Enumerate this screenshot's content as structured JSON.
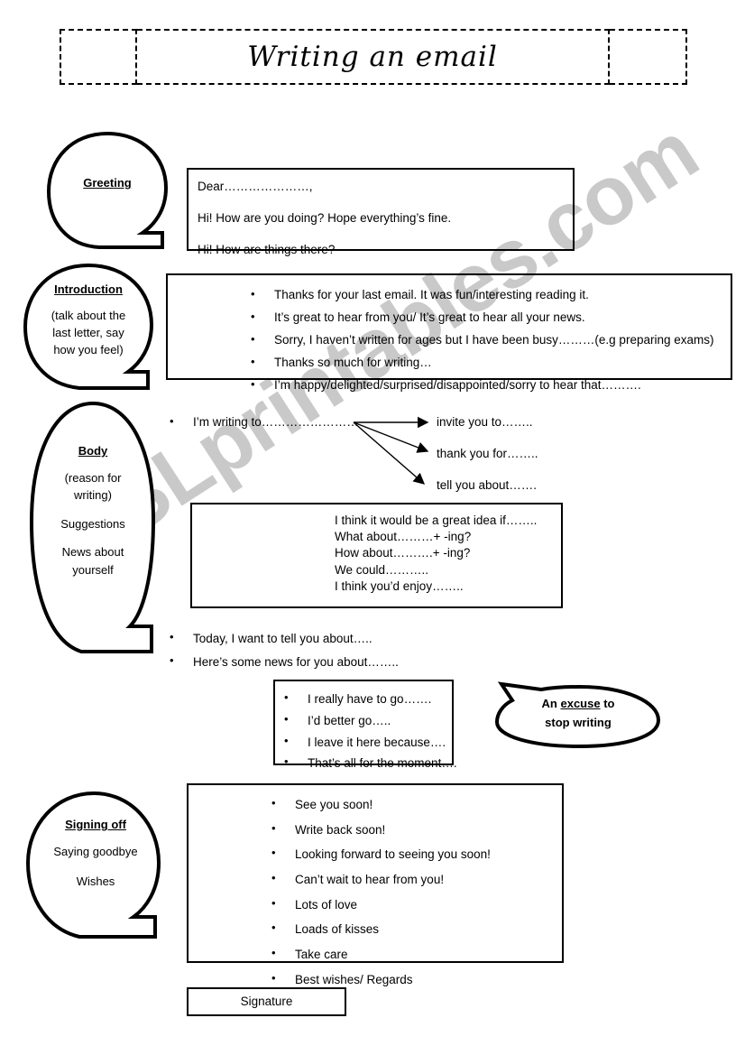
{
  "title": "Writing an email",
  "watermark": "ESLprintables.com",
  "sections": {
    "greeting": {
      "bubble": {
        "title": "Greeting",
        "lines": []
      },
      "lines": [
        "Dear…………………,",
        "Hi! How are you doing? Hope everything’s fine.",
        "Hi! How are things there?"
      ]
    },
    "introduction": {
      "bubble": {
        "title": "Introduction",
        "lines": [
          "(talk about the",
          "last letter, say",
          "how you feel)"
        ]
      },
      "bullets": [
        "Thanks for your last email. It was fun/interesting reading it.",
        "It’s great to hear from you/ It’s great to hear all your news.",
        "Sorry, I haven’t written for ages but I have been busy………(e.g preparing exams)",
        "Thanks so much for writing…",
        "I’m happy/delighted/surprised/disappointed/sorry to hear that………."
      ]
    },
    "body": {
      "bubble": {
        "title": "Body",
        "lines": [
          "(reason for",
          "writing)",
          "Suggestions",
          "News about",
          "yourself"
        ]
      },
      "writing_to_bullet": "I’m writing to……………………",
      "arrow_targets": [
        "invite you to……..",
        "thank you for……..",
        "tell you about……."
      ],
      "suggestion_lines": [
        "I think it would be a great idea if……..",
        "What about………+ -ing?",
        "How about……….+ -ing?",
        "We could………..",
        "I think you’d enjoy…….."
      ],
      "news_bullets": [
        "Today, I want to tell you about…..",
        "Here’s some news for you about…….."
      ],
      "closing_bullets": [
        "I really have to go…….",
        "I’d better go…..",
        "I leave it here because….",
        "That’s all for the moment…."
      ]
    },
    "excuse": {
      "line1_before": "An ",
      "line1_underlined": "excuse",
      "line1_after": " to",
      "line2": "stop writing"
    },
    "signing_off": {
      "bubble": {
        "title": "Signing off",
        "lines": [
          "Saying goodbye",
          "Wishes"
        ]
      },
      "bullets": [
        "See you soon!",
        "Write back soon!",
        "Looking forward to seeing you soon!",
        "Can’t wait to hear from you!",
        "Lots of love",
        "Loads of kisses",
        "Take care",
        "Best wishes/ Regards"
      ]
    },
    "signature": {
      "label": "Signature"
    }
  }
}
